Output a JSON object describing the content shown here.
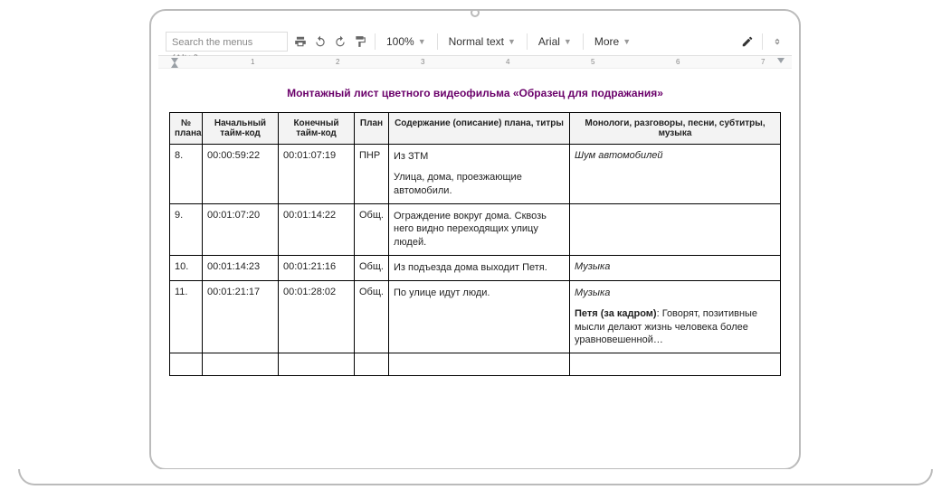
{
  "toolbar": {
    "search_placeholder": "Search the menus (Alt+/)",
    "zoom": "100%",
    "style": "Normal text",
    "font": "Arial",
    "more": "More"
  },
  "ruler": {
    "marks": [
      "1",
      "2",
      "3",
      "4",
      "5",
      "6",
      "7"
    ]
  },
  "doc": {
    "title": "Монтажный лист цветного видеофильма «Образец для подражания»",
    "headers": {
      "n": "№ плана",
      "tc_start": "Начальный тайм-код",
      "tc_end": "Конечный тайм-код",
      "plan": "План",
      "desc": "Содержание (описание) плана, титры",
      "mono": "Монологи, разговоры, песни, субтитры, музыка"
    },
    "rows": [
      {
        "n": "8.",
        "tc_start": "00:00:59:22",
        "tc_end": "00:01:07:19",
        "plan": "ПНР",
        "desc_1": "Из ЗТМ",
        "desc_2": "Улица, дома, проезжающие автомобили.",
        "mono_sound": "Шум автомобилей"
      },
      {
        "n": "9.",
        "tc_start": "00:01:07:20",
        "tc_end": "00:01:14:22",
        "plan": "Общ.",
        "desc_1": "Ограждение вокруг дома. Сквозь него видно переходящих улицу людей.",
        "mono_sound": ""
      },
      {
        "n": "10.",
        "tc_start": "00:01:14:23",
        "tc_end": "00:01:21:16",
        "plan": "Общ.",
        "desc_1": "Из подъезда дома выходит Петя.",
        "mono_sound": "Музыка"
      },
      {
        "n": "11.",
        "tc_start": "00:01:21:17",
        "tc_end": "00:01:28:02",
        "plan": "Общ.",
        "desc_1": "По улице идут люди.",
        "mono_sound": "Музыка",
        "mono_speaker": "Петя (за кадром)",
        "mono_text": ": Говорят, позитивные мысли делают жизнь человека более уравновешенной…"
      }
    ]
  }
}
